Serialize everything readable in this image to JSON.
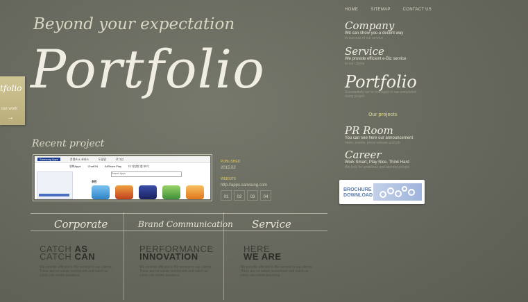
{
  "topnav": {
    "home": "HOME",
    "sitemap": "SITEMAP",
    "contact": "CONTACT US"
  },
  "hero": {
    "tagline": "Beyond your expectation",
    "title": "Portfolio"
  },
  "side_tab": {
    "title": "tfolio",
    "sub": "our work",
    "arrow": "→"
  },
  "recent": {
    "label": "Recent project",
    "screenshot": {
      "logo": "Samsung Apps",
      "top_links": [
        "콘텐츠 & 서비스",
        "도움말",
        "로그인"
      ],
      "nav": [
        "영화Apps",
        "ChatON",
        "AllShare Play",
        "더 다양한 앱 보기"
      ],
      "search": "Search Apps",
      "section": "추천"
    },
    "published_label": "PUBLISHED",
    "published": "2015.02",
    "url_label": "WEBSITE",
    "url": "http://apps.samsung.com",
    "pages": [
      "01",
      "02",
      "03",
      "04"
    ]
  },
  "columns": [
    {
      "head": "Corporate",
      "line1a": "CATCH ",
      "line1b": "AS",
      "line2a": "CATCH ",
      "line2b": "CAN",
      "desc": "We provide efficient e-Biz service to our clients. There are no waste investment and catch as catch can online business"
    },
    {
      "head": "Brand Communication",
      "line1a": "PERFORMANCE",
      "line1b": "",
      "line2a": "",
      "line2b": "INNOVATION",
      "desc": "We provide efficient e-Biz service to our clients. There are no waste investment and catch as catch can online business"
    },
    {
      "head": "Service",
      "line1a": "HERE",
      "line1b": "",
      "line2a": "",
      "line2b": "WE ARE",
      "desc": "We provide efficient e-Biz service to our clients. There are no waste investment and catch as catch can online business"
    }
  ],
  "menu": [
    {
      "title": "Company",
      "desc": "We can show you a decent way",
      "desc2": "to success of our service"
    },
    {
      "title": "Service",
      "desc": "We provide efficient e-Biz service",
      "desc2": "to our clients"
    },
    {
      "title": "Portfolio",
      "desc": "",
      "desc2": "Successfully we've managed to our completed many project"
    },
    {
      "title": "PR Room",
      "desc": "You can see here our announcement",
      "desc2": "news, events, press release and job"
    },
    {
      "title": "Career",
      "desc": "Work Smart, Play Nice, Think Hard",
      "desc2": "We look for ambitious and talented people"
    }
  ],
  "our_projects": "Our projects",
  "brochure": {
    "line1": "BROCHURE",
    "line2": "DOWNLOAD"
  }
}
